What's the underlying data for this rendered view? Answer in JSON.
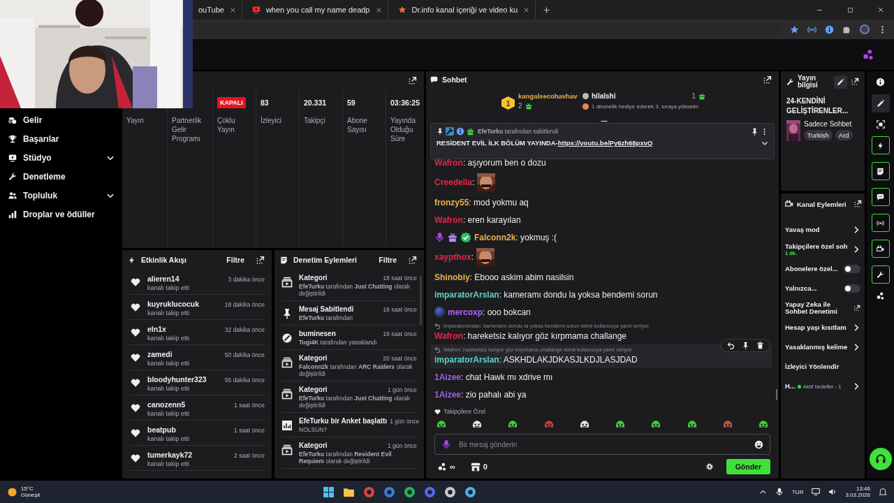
{
  "browser": {
    "tabs": [
      {
        "title": "ouTube",
        "kind": "plain"
      },
      {
        "title": "when you call my name deadp",
        "kind": "video"
      },
      {
        "title": "Dr.info kanal içeriği ve video ku",
        "kind": "burst"
      }
    ]
  },
  "sidebar": {
    "items": [
      {
        "label": "Gelir",
        "expandable": false
      },
      {
        "label": "Başarılar",
        "expandable": false
      },
      {
        "label": "Stüdyo",
        "expandable": true
      },
      {
        "label": "Denetleme",
        "expandable": false
      },
      {
        "label": "Topluluk",
        "expandable": true
      },
      {
        "label": "Droplar ve ödüller",
        "expandable": false
      }
    ]
  },
  "stats": [
    {
      "kind": "label",
      "label": "Yayın"
    },
    {
      "kind": "label",
      "label": "Partnerlik Gelir Programı"
    },
    {
      "kind": "badge",
      "value": "KAPALI",
      "label": "Çoklu Yayın"
    },
    {
      "kind": "number",
      "value": "83",
      "label": "İzleyici"
    },
    {
      "kind": "number",
      "value": "20.331",
      "label": "Takipçi"
    },
    {
      "kind": "number",
      "value": "59",
      "label": "Abone Sayısı"
    },
    {
      "kind": "number",
      "value": "03:36:25",
      "label": "Yayında Olduğu Süre"
    }
  ],
  "activity": {
    "title": "Etkinlik Akışı",
    "filter": "Filtre",
    "items": [
      {
        "user": "alieren14",
        "time": "3 dakika önce",
        "action": "kanalı takip etti"
      },
      {
        "user": "kuyruklucocuk",
        "time": "18 dakika önce",
        "action": "kanalı takip etti"
      },
      {
        "user": "eln1x",
        "time": "32 dakika önce",
        "action": "kanalı takip etti"
      },
      {
        "user": "zamedi",
        "time": "50 dakika önce",
        "action": "kanalı takip etti"
      },
      {
        "user": "bloodyhunter323",
        "time": "55 dakika önce",
        "action": "kanalı takip etti"
      },
      {
        "user": "canozenn5",
        "time": "1 saat önce",
        "action": "kanalı takip etti"
      },
      {
        "user": "beatpub",
        "time": "1 saat önce",
        "action": "kanalı takip etti"
      },
      {
        "user": "tumerkayk72",
        "time": "2 saat önce",
        "action": "kanalı takip etti"
      }
    ]
  },
  "moderation": {
    "title": "Denetim Eylemleri",
    "filter": "Filtre",
    "items": [
      {
        "kind": "category",
        "title": "Kategori",
        "time": "18 saat önce",
        "detail": "**EfeTurku** tarafından **Just Chatting** olarak değiştirildi"
      },
      {
        "kind": "pin",
        "title": "Mesaj Sabitlendi",
        "time": "18 saat önce",
        "detail": "**EfeTurku** tarafından"
      },
      {
        "kind": "ban",
        "title": "buminesen",
        "time": "19 saat önce",
        "detail": "**Tugi4K** tarafından yasaklandı"
      },
      {
        "kind": "category",
        "title": "Kategori",
        "time": "20 saat önce",
        "detail": "**Falconn2k** tarafından **ARC Raiders** olarak değiştirildi"
      },
      {
        "kind": "category",
        "title": "Kategori",
        "time": "1 gün önce",
        "detail": "**EfeTurku** tarafından **Just Chatting** olarak değiştirildi"
      },
      {
        "kind": "poll",
        "title": "**EfeTurku** bir Anket başlattı",
        "time": "1 gün önce",
        "detail": "NOLSUN?"
      },
      {
        "kind": "category",
        "title": "Kategori",
        "time": "1 gün önce",
        "detail": "**EfeTurku** tarafından **Resident Evil Requiem** olarak değiştirildi"
      }
    ]
  },
  "chat": {
    "title": "Sohbet",
    "top_gifter": {
      "rank": "1",
      "name": "kangalsecohavhav",
      "gifts": "2"
    },
    "second_gifter": {
      "name": "hilalshi",
      "gifts": "1",
      "hint": "1 abonelik hediye ederek 3. sıraya yükselin"
    },
    "pinned": {
      "by": "**EfeTurku** tarafından sabitlendi",
      "text": "RESİDENT EVİL İLK BÖLÜM YAYINDA-",
      "link": "https://youtu.be/Py6zh68pxvQ"
    },
    "messages": [
      {
        "user": "Wafron",
        "color": "#e0284a",
        "text": ": aşıyorum ben o dozu",
        "emote": false,
        "hovered": false
      },
      {
        "user": "Creedella",
        "color": "#e0284a",
        "text": ":",
        "emote": true,
        "hovered": false
      },
      {
        "user": "fronzy55",
        "color": "#e8b14a",
        "text": ": mod yokmu aq",
        "emote": false,
        "hovered": false
      },
      {
        "user": "Wafron",
        "color": "#e0284a",
        "text": ": eren karayılan",
        "emote": false,
        "hovered": false
      },
      {
        "user": "Falconn2k",
        "color": "#e8b14a",
        "badges": [
          {
            "kind": "mic"
          },
          {
            "kind": "gift"
          },
          {
            "kind": "verified"
          }
        ],
        "text": ": yokmuş :(",
        "emote": false,
        "hovered": false
      },
      {
        "user": "xaypthox",
        "color": "#e0284a",
        "text": ":",
        "emote": true,
        "hovered": false
      },
      {
        "user": "Shinobiy",
        "color": "#e8b14a",
        "text": ": Ebooo askim abim nasilsin",
        "emote": false,
        "hovered": false
      },
      {
        "user": "imparatorArslan",
        "color": "#5fd3c4",
        "text": ": kameramı dondu la yoksa bendemi sorun",
        "emote": false,
        "hovered": false
      },
      {
        "user": "mercoxp",
        "color": "#b462f5",
        "badges": [
          {
            "kind": "avatar"
          }
        ],
        "text": ": ooo bokcan",
        "emote": false,
        "hovered": false
      },
      {
        "reply": "imparatorArslan: kameramı dondu la yoksa bendemi sorun isimli kullanıcıya yanıt veriyor",
        "user": "Wafron",
        "color": "#e0284a",
        "text": ": hareketsiz kalıyor göz kırpmama challange",
        "emote": false,
        "hovered": false
      },
      {
        "reply": "Wafron: hareketsiz kalıyor göz kırpmama challange isimli kullanıcıya yanıt veriyor",
        "user": "imparatorArslan",
        "color": "#5fd3c4",
        "text": ": ASKHDLAKJDKASJLKDJLASJDAD",
        "emote": false,
        "hovered": true
      },
      {
        "user": "1Aizee",
        "color": "#a45cf0",
        "text": ": chat Hawk mı xdrive mı",
        "emote": false,
        "hovered": false
      },
      {
        "user": "1Aizee",
        "color": "#a45cf0",
        "text": ": zio pahalı abi ya",
        "emote": false,
        "hovered": false
      }
    ],
    "emote_bar": {
      "label": "Takipçilere Özel",
      "emotes": [
        {
          "color": "#3fd23a"
        },
        {
          "color": "#dfe8dc"
        },
        {
          "color": "#3fd23a"
        },
        {
          "color": "#d23a3a"
        },
        {
          "color": "#dfe8dc"
        },
        {
          "color": "#3fd23a"
        },
        {
          "color": "#3fd23a"
        },
        {
          "color": "#3fd23a"
        },
        {
          "color": "#c8553a"
        },
        {
          "color": "#3fd23a"
        }
      ]
    },
    "input": {
      "placeholder": "Bir mesaj gönderin"
    },
    "points": "∞",
    "bits": "0",
    "send": "Gönder"
  },
  "stream_info": {
    "title": "Yayın bilgisi",
    "stream_title": "24-KENDİNİ GELİŞTİRENLER...",
    "category": "Sadece Sohbet",
    "tags": [
      "Turkish",
      "Ard"
    ]
  },
  "channel_actions": {
    "title": "Kanal Eylemleri",
    "items": [
      {
        "kind": "link",
        "label": "Yavaş mod"
      },
      {
        "kind": "link",
        "label": "Takipçilere özel soh",
        "sub": "1 dk."
      },
      {
        "kind": "toggle",
        "label": "Abonelere özel...",
        "on": false
      },
      {
        "kind": "toggle",
        "label": "Yalnızca...",
        "on": false
      },
      {
        "kind": "external",
        "label": "Yapay Zeka ile Sohbet Denetimi"
      },
      {
        "kind": "link",
        "label": "Hesap yaşı kısıtlam"
      },
      {
        "kind": "link",
        "label": "Yasaklanmış kelime"
      },
      {
        "kind": "plain",
        "label": "İzleyici Yönlendir"
      },
      {
        "kind": "link",
        "label": "H...",
        "status": "Aktif hedefler - 1"
      }
    ]
  },
  "taskbar": {
    "temperature": "15°C",
    "weather": "Güneşli",
    "language": "TUR",
    "time": "13:46",
    "date": "3.03.2026"
  }
}
